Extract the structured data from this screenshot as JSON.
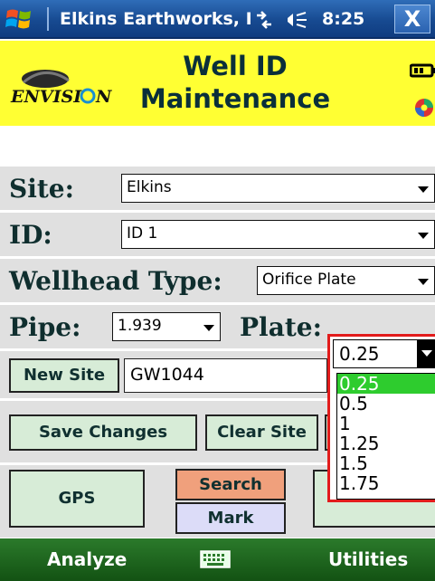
{
  "titlebar": {
    "title": "Elkins Earthworks, I",
    "time": "8:25",
    "close_label": "X",
    "icons": [
      "windows-start-icon",
      "network-icon",
      "volume-icon"
    ]
  },
  "header": {
    "logo_text": "ENVISION",
    "title": "Well ID Maintenance",
    "icons": [
      "battery-icon",
      "disc-icon"
    ]
  },
  "form": {
    "site": {
      "label": "Site:",
      "value": "Elkins"
    },
    "id": {
      "label": "ID:",
      "value": "ID 1"
    },
    "wellhead_type": {
      "label": "Wellhead Type:",
      "value": "Orifice Plate"
    },
    "pipe": {
      "label": "Pipe:",
      "value": "1.939"
    },
    "plate": {
      "label": "Plate:",
      "value": "0.25",
      "options": [
        "0.25",
        "0.5",
        "1",
        "1.25",
        "1.5",
        "1.75"
      ],
      "selected_index": 0
    },
    "new_site": {
      "button_label": "New Site",
      "value": "GW1044"
    }
  },
  "buttons": {
    "save_changes": "Save Changes",
    "clear_site": "Clear Site",
    "gps": "GPS",
    "search": "Search",
    "mark": "Mark"
  },
  "softkeys": {
    "left": "Analyze",
    "right": "Utilities"
  },
  "colors": {
    "header_bg": "#ffff33",
    "button_bg": "#d7ecd7",
    "search_bg": "#f0a07c",
    "mark_bg": "#dcdcf8",
    "dropdown_border": "#e21c1c",
    "dropdown_highlight": "#2ecc2e",
    "softkey_bar": "#1d641d"
  }
}
